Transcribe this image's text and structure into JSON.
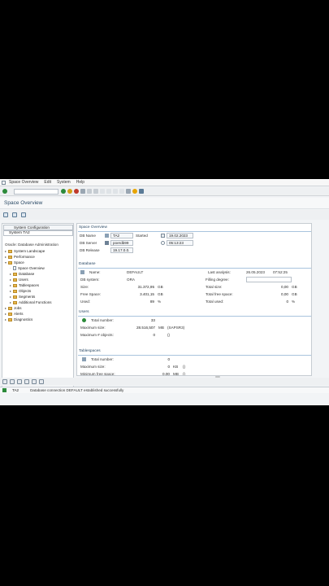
{
  "menu": [
    "Space Overview",
    "Edit",
    "System",
    "Help"
  ],
  "title": "Space Overview",
  "left_panel": {
    "system_config": "System Configuration",
    "system": "System TA2",
    "tree_header": "Oracle: Database Administration",
    "tree": [
      {
        "label": "System Landscape",
        "level": 0,
        "type": "folder"
      },
      {
        "label": "Performance",
        "level": 0,
        "type": "folder"
      },
      {
        "label": "Space",
        "level": 0,
        "type": "folder"
      },
      {
        "label": "Space Overview",
        "level": 1,
        "type": "doc"
      },
      {
        "label": "Database",
        "level": 1,
        "type": "folder"
      },
      {
        "label": "Users",
        "level": 1,
        "type": "folder"
      },
      {
        "label": "Tablespaces",
        "level": 1,
        "type": "folder"
      },
      {
        "label": "Objects",
        "level": 1,
        "type": "folder"
      },
      {
        "label": "Segments",
        "level": 1,
        "type": "folder"
      },
      {
        "label": "Additional Functions",
        "level": 1,
        "type": "folder"
      },
      {
        "label": "Jobs",
        "level": 0,
        "type": "folder"
      },
      {
        "label": "Alerts",
        "level": 0,
        "type": "folder"
      },
      {
        "label": "Diagnostics",
        "level": 0,
        "type": "folder"
      }
    ]
  },
  "space_overview": {
    "title": "Space Overview",
    "db_name_label": "DB Name",
    "db_name": "TA2",
    "db_server_label": "DB Server",
    "db_server": "poerdb99",
    "db_release_label": "DB Release",
    "db_release": "19.17.0.0.",
    "started_label": "Started",
    "started_date": "19.02.2023",
    "started_time": "05:13:23"
  },
  "database": {
    "title": "Database",
    "name_label": "Name:",
    "name": "DEFAULT",
    "db_system_label": "DB system:",
    "db_system": "ORA",
    "size_label": "Size:",
    "size": "31.372,95",
    "size_unit": "GB",
    "free_space_label": "Free Space:",
    "free_space": "3.401,15",
    "free_space_unit": "GB",
    "used_label": "Used:",
    "used": "89",
    "used_unit": "%",
    "last_analysis_label": "Last analysis:",
    "last_analysis_date": "26.05.2023",
    "last_analysis_time": "07:52:25",
    "filling_degree_label": "Filling degree:",
    "total_size_label": "Total size:",
    "total_size": "0,00",
    "total_size_unit": "GB",
    "total_free_label": "Total free space:",
    "total_free": "0,00",
    "total_free_unit": "GB",
    "total_used_label": "Total used:",
    "total_used": "0",
    "total_used_unit": "%"
  },
  "users": {
    "title": "Users",
    "total_number_label": "Total number:",
    "total_number": "33",
    "max_size_label": "Maximum size:",
    "max_size": "28.516,507",
    "max_size_unit": "MB",
    "max_size_user": "(SAPSR3)",
    "max_objects_label": "Maximum # objects:",
    "max_objects": "0",
    "max_objects_paren": "()"
  },
  "tablespaces": {
    "title": "Tablespaces",
    "total_number_label": "Total number:",
    "total_number": "0",
    "max_size_label": "Maximum size:",
    "max_size": "0",
    "max_size_unit": "KB",
    "max_size_paren": "()",
    "min_free_label": "Minimum free space:",
    "min_free": "0,00",
    "min_free_unit": "MB",
    "min_free_paren": "()"
  },
  "status": {
    "system": "TA2",
    "message": "Database connection DEFAULT established successfully"
  },
  "colors": {
    "accent": "#2b4a66",
    "ok": "#2c8a3a",
    "folder": "#e8b84a"
  }
}
